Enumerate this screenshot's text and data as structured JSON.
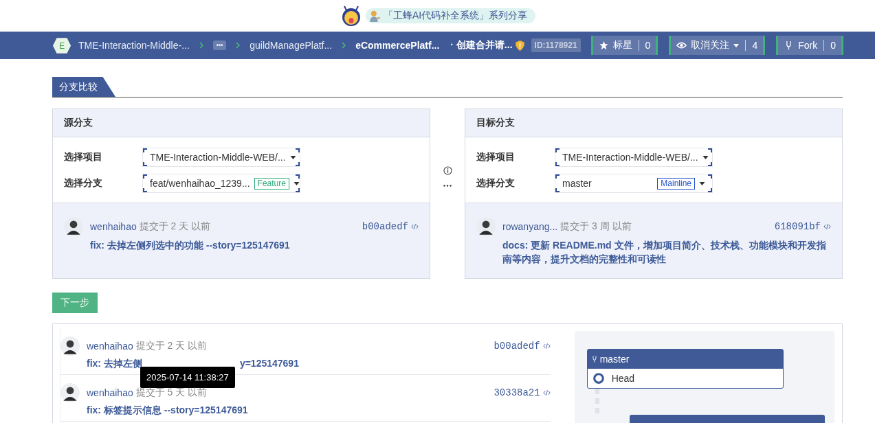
{
  "banner": {
    "text": "「工蜂AI代码补全系统」系列分享"
  },
  "breadcrumb": {
    "group_initial": "E",
    "items": [
      {
        "kind": "link",
        "label": "TME-Interaction-Middle-..."
      },
      {
        "kind": "more",
        "label": "•••"
      },
      {
        "kind": "link",
        "label": "guildManagePlatf..."
      },
      {
        "kind": "current",
        "label": "eCommercePlatf..."
      }
    ],
    "page": "· 创建合并请...",
    "id": "ID:1178921"
  },
  "actions": [
    {
      "kind": "star",
      "label": "标星",
      "count": "0",
      "dropdown": false
    },
    {
      "kind": "watch",
      "label": "取消关注",
      "count": "4",
      "dropdown": true
    },
    {
      "kind": "fork",
      "label": "Fork",
      "count": "0",
      "dropdown": false
    }
  ],
  "tab": "分支比较",
  "panels": [
    {
      "title": "源分支",
      "fields": [
        {
          "label": "选择项目",
          "value": "TME-Interaction-Middle-WEB/..."
        },
        {
          "label": "选择分支",
          "value": "feat/wenhaihao_1239...",
          "tag": {
            "text": "Feature",
            "color": "#2aa876"
          }
        }
      ],
      "commit": {
        "author": "wenhaihao",
        "when": "提交于 2 天 以前",
        "sha": "b00adedf",
        "message": "fix: 去掉左侧列选中的功能 --story=125147691"
      }
    },
    {
      "title": "目标分支",
      "fields": [
        {
          "label": "选择项目",
          "value": "TME-Interaction-Middle-WEB/..."
        },
        {
          "label": "选择分支",
          "value": "master",
          "tag": {
            "text": "Mainline",
            "color": "#1f4fd1"
          }
        }
      ],
      "commit": {
        "author": "rowanyang...",
        "when": "提交于 3 周 以前",
        "sha": "618091bf",
        "message": "docs: 更新 README.md 文件，增加项目简介、技术栈、功能模块和开发指南等内容，提升文档的完整性和可读性"
      }
    }
  ],
  "next_button": "下一步",
  "commits": [
    {
      "author": "wenhaihao",
      "when": "提交于 2 天 以前",
      "sha": "b00adedf",
      "message_parts": [
        "fix: 去掉左侧",
        "y=125147691"
      ],
      "tooltip": "2025-07-14 11:38:27"
    },
    {
      "author": "wenhaihao",
      "when": "提交于 5 天 以前",
      "sha": "30338a21",
      "message_parts": [
        "fix: 标签提示信息 --story=125147691"
      ]
    }
  ],
  "graph": {
    "branch": "master",
    "node": "Head"
  }
}
